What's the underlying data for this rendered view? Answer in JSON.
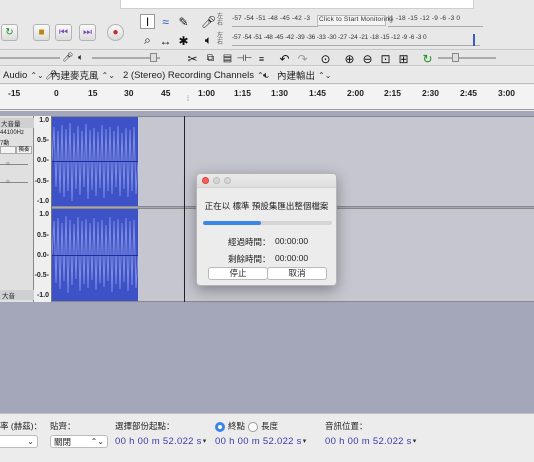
{
  "colors": {
    "waveform": "#3e52c7",
    "track_bg": "#c5c6cf",
    "accent": "#3b86e7",
    "timecode": "#3a3aa8"
  },
  "meters": {
    "record": {
      "channels": [
        "左",
        "右"
      ],
      "scale": "-57 -54 -51 -48 -45 -42 -3",
      "hint": "Click to Start Monitoring",
      "scale_tail": "!1 -18 -15 -12 -9 -6 -3 0"
    },
    "playback": {
      "channels": [
        "左",
        "右"
      ],
      "scale": "-57 -54 -51 -48 -45 -42 -39 -36 -33 -30 -27 -24 -21 -18 -15 -12 -9 -6 -3 0"
    }
  },
  "device_toolbar": {
    "host": "Audio",
    "recording_device": "內建麥克風",
    "channels": "2 (Stereo) Recording Channels",
    "playback_device": "內建輸出"
  },
  "ruler": {
    "ticks": [
      "-15",
      "0",
      "15",
      "30",
      "45",
      "1:00",
      "1:15",
      "1:30",
      "1:45",
      "2:00",
      "2:15",
      "2:30",
      "2:45",
      "3:00"
    ]
  },
  "track": {
    "name": "大音量",
    "rate": "44100Hz",
    "format": "7動",
    "mute_label": "獨奏",
    "vruler": [
      "1.0",
      "0.5-",
      "0.0-",
      "-0.5-",
      "-1.0",
      "1.0",
      "0.5-",
      "0.0-",
      "-0.5-",
      "-1.0"
    ],
    "bottom_label": "大音"
  },
  "dialog": {
    "message": "正在以 標準 預設集匯出整個檔案",
    "progress": 0.45,
    "elapsed_label": "經過時間：",
    "elapsed_value": "00:00:00",
    "remaining_label": "剩餘時間：",
    "remaining_value": "00:00:00",
    "stop_label": "停止",
    "cancel_label": "取消"
  },
  "selection_bar": {
    "rate_label": "率 (赫茲)：",
    "snap_label": "貼齊：",
    "snap_value": "關閉",
    "start_label": "選擇部份起點：",
    "end_label": "終點",
    "length_label": "長度",
    "position_label": "音訊位置：",
    "start_time": "00 h 00 m 52.022 s",
    "end_time": "00 h 00 m 52.022 s",
    "position_time": "00 h 00 m 52.022 s"
  }
}
